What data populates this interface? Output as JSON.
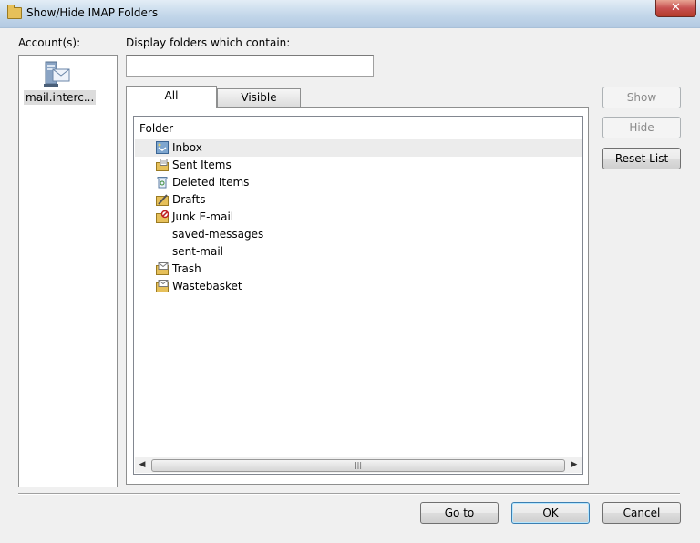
{
  "window": {
    "title": "Show/Hide IMAP Folders",
    "close_label": "✕"
  },
  "accounts": {
    "label": "Account(s):",
    "items": [
      {
        "label": "mail.interc..."
      }
    ]
  },
  "filter": {
    "label": "Display folders which contain:",
    "value": "",
    "placeholder": ""
  },
  "tabs": [
    {
      "label": "All",
      "active": true
    },
    {
      "label": "Visible",
      "active": false
    }
  ],
  "folder_list": {
    "column_header": "Folder",
    "rows": [
      {
        "label": "Inbox",
        "icon": "inbox-icon",
        "selected": true
      },
      {
        "label": "Sent Items",
        "icon": "sent-items-icon"
      },
      {
        "label": "Deleted Items",
        "icon": "deleted-items-icon"
      },
      {
        "label": "Drafts",
        "icon": "drafts-icon"
      },
      {
        "label": "Junk E-mail",
        "icon": "junk-icon"
      },
      {
        "label": "saved-messages",
        "icon": ""
      },
      {
        "label": "sent-mail",
        "icon": ""
      },
      {
        "label": "Trash",
        "icon": "mail-folder-icon"
      },
      {
        "label": "Wastebasket",
        "icon": "mail-folder-icon"
      }
    ]
  },
  "side_buttons": {
    "show": "Show",
    "hide": "Hide",
    "reset": "Reset List"
  },
  "footer_buttons": {
    "goto": "Go to",
    "ok": "OK",
    "cancel": "Cancel"
  },
  "colors": {
    "selection": "#ececec",
    "folder": "#e6c05a",
    "title_gradient_top": "#e3edf6"
  }
}
